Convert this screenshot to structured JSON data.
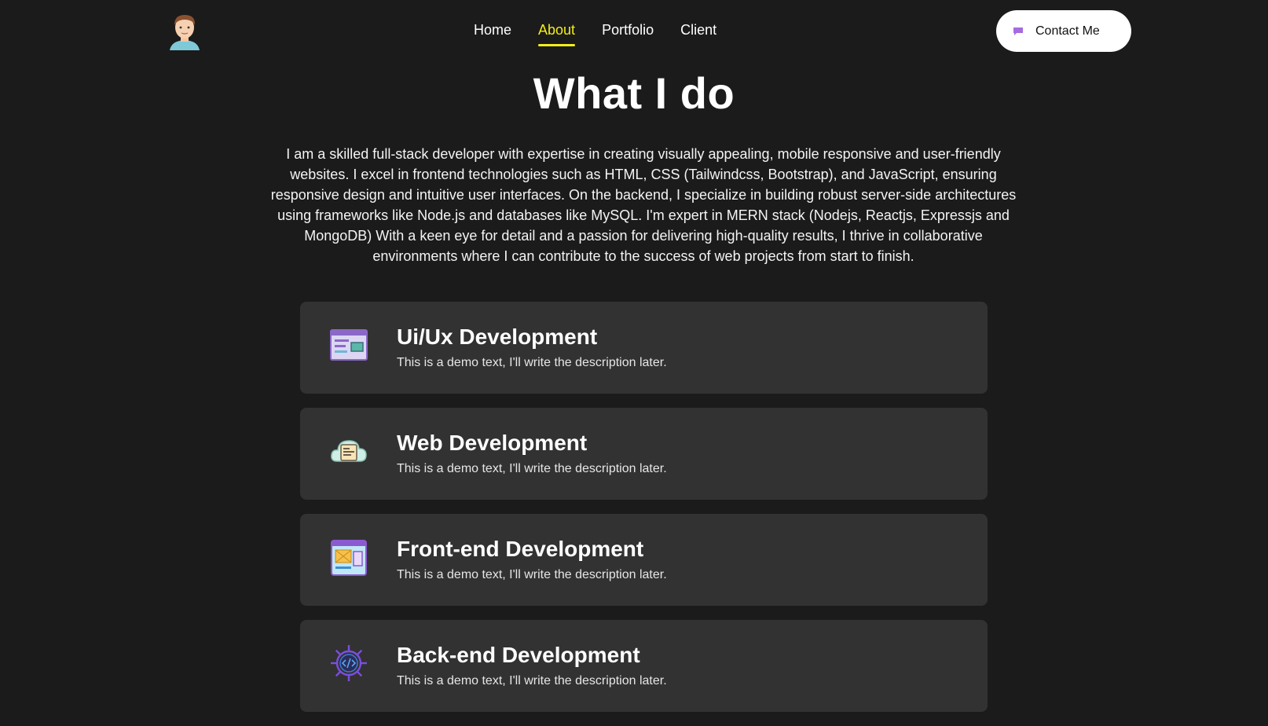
{
  "nav": {
    "links": [
      {
        "label": "Home",
        "active": false
      },
      {
        "label": "About",
        "active": true
      },
      {
        "label": "Portfolio",
        "active": false
      },
      {
        "label": "Client",
        "active": false
      }
    ],
    "contact_label": "Contact Me",
    "accent_color": "#f2ee1b"
  },
  "main": {
    "title": "What I do",
    "intro": "I am a skilled full-stack developer with expertise in creating visually appealing, mobile responsive and user-friendly websites. I excel in frontend technologies such as HTML, CSS (Tailwindcss, Bootstrap), and JavaScript, ensuring responsive design and intuitive user interfaces. On the backend, I specialize in building robust server-side architectures using frameworks like Node.js and databases like MySQL. I'm expert in MERN stack (Nodejs, Reactjs, Expressjs and MongoDB) With a keen eye for detail and a passion for delivering high-quality results, I thrive in collaborative environments where I can contribute to the success of web projects from start to finish."
  },
  "services": [
    {
      "title": "Ui/Ux Development",
      "description": "This is a demo text, I'll write the description later.",
      "icon": "browser-window-icon"
    },
    {
      "title": "Web Development",
      "description": "This is a demo text, I'll write the description later.",
      "icon": "cloud-web-icon"
    },
    {
      "title": "Front-end Development",
      "description": "This is a demo text, I'll write the description later.",
      "icon": "frontend-layout-icon"
    },
    {
      "title": "Back-end Development",
      "description": "This is a demo text, I'll write the description later.",
      "icon": "gear-code-icon"
    }
  ]
}
